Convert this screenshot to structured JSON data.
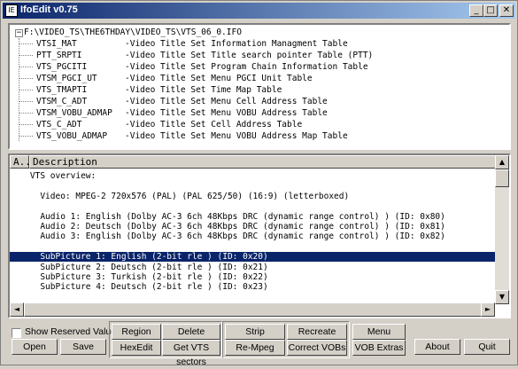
{
  "window": {
    "title": "IfoEdit v0.75",
    "app_icon_glyph": "IE",
    "minimize_glyph": "_",
    "maximize_glyph": "□",
    "close_glyph": "✕"
  },
  "tree": {
    "root_label": "F:\\VIDEO_TS\\THE6THDAY\\VIDEO_TS\\VTS_06_0.IFO",
    "expander_glyph": "−",
    "items": [
      {
        "name": "VTSI_MAT",
        "desc": "-Video Title Set Information Managment Table"
      },
      {
        "name": "PTT_SRPTI",
        "desc": "-Video Title Set Title search pointer Table (PTT)"
      },
      {
        "name": "VTS_PGCITI",
        "desc": "-Video Title Set Program Chain Information Table"
      },
      {
        "name": "VTSM_PGCI_UT",
        "desc": "-Video Title Set Menu PGCI Unit Table"
      },
      {
        "name": "VTS_TMAPTI",
        "desc": "-Video Title Set Time Map Table"
      },
      {
        "name": "VTSM_C_ADT",
        "desc": "-Video Title Set Menu Cell Address Table"
      },
      {
        "name": "VTSM_VOBU_ADMAP",
        "desc": "-Video Title Set Menu VOBU Address Table"
      },
      {
        "name": "VTS_C_ADT",
        "desc": "-Video Title Set Cell Address Table"
      },
      {
        "name": "VTS_VOBU_ADMAP",
        "desc": "-Video Title Set Menu VOBU Address Map Table"
      }
    ]
  },
  "list": {
    "headers": {
      "address": "A..",
      "description": "Description"
    },
    "rows": [
      {
        "text": "    VTS overview:",
        "selected": false
      },
      {
        "text": "",
        "selected": false
      },
      {
        "text": "      Video: MPEG-2 720x576 (PAL) (PAL 625/50) (16:9) (letterboxed)",
        "selected": false
      },
      {
        "text": "",
        "selected": false
      },
      {
        "text": "      Audio 1: English (Dolby AC-3 6ch 48Kbps DRC (dynamic range control) ) (ID: 0x80)",
        "selected": false
      },
      {
        "text": "      Audio 2: Deutsch (Dolby AC-3 6ch 48Kbps DRC (dynamic range control) ) (ID: 0x81)",
        "selected": false
      },
      {
        "text": "      Audio 3: English (Dolby AC-3 6ch 48Kbps DRC (dynamic range control) ) (ID: 0x82)",
        "selected": false
      },
      {
        "text": "",
        "selected": false
      },
      {
        "text": "      SubPicture 1: English (2-bit rle ) (ID: 0x20)",
        "selected": true
      },
      {
        "text": "      SubPicture 2: Deutsch (2-bit rle ) (ID: 0x21)",
        "selected": false
      },
      {
        "text": "      SubPicture 3: Turkish (2-bit rle ) (ID: 0x22)",
        "selected": false
      },
      {
        "text": "      SubPicture 4: Deutsch (2-bit rle ) (ID: 0x23)",
        "selected": false
      }
    ],
    "scroll_up_glyph": "▲",
    "scroll_down_glyph": "▼",
    "scroll_left_glyph": "◄",
    "scroll_right_glyph": "►"
  },
  "controls": {
    "show_reserved_label": "Show Reserved Values",
    "show_reserved_checked": false,
    "buttons": {
      "open": "Open",
      "save": "Save",
      "region_free": "Region free",
      "hexedit": "HexEdit",
      "delete_playback": "Delete Playback",
      "get_vts_sectors": "Get VTS sectors",
      "strip": "Strip",
      "re_mpeg": "Re-Mpeg",
      "recreate_tables": "Recreate tables",
      "correct_vobs": "Correct VOBs",
      "menu_extras": "Menu Extras",
      "vob_extras": "VOB Extras",
      "about": "About",
      "quit": "Quit"
    }
  },
  "colors": {
    "face": "#d4d0c8",
    "selection": "#0a246a",
    "title_gradient_start": "#0a246a",
    "title_gradient_end": "#a6caf0"
  }
}
